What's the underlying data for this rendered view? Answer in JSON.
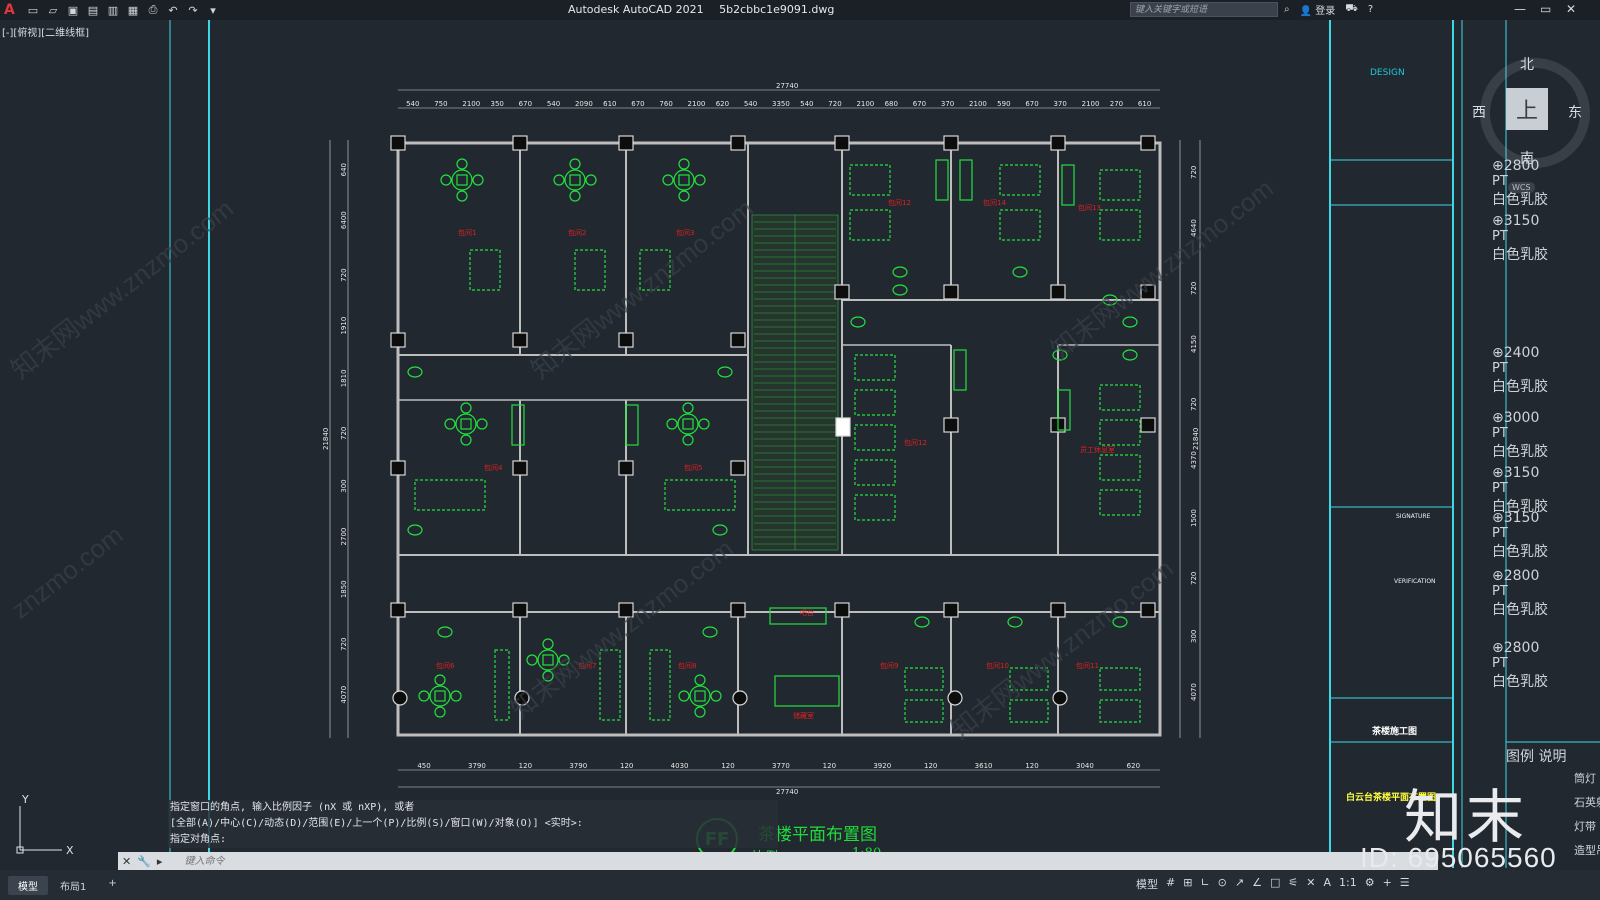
{
  "app": {
    "title": "Autodesk AutoCAD 2021",
    "file": "5b2cbbc1e9091.dwg",
    "logo": "A"
  },
  "search": {
    "placeholder": "键入关键字或短语"
  },
  "user": {
    "login": "登录"
  },
  "viewport": {
    "label": "[-][俯视][二维线框]"
  },
  "compass": {
    "north": "北",
    "south": "南",
    "east": "东",
    "west": "西",
    "top": "上",
    "wcs": "WCS"
  },
  "plan": {
    "total_width": "27740",
    "top_dims": [
      "540",
      "750",
      "2100",
      "350",
      "670",
      "540",
      "2090",
      "610",
      "670",
      "760",
      "2100",
      "620",
      "540",
      "3350",
      "540",
      "720",
      "2100",
      "680",
      "670",
      "370",
      "2100",
      "590",
      "670",
      "370",
      "2100",
      "270",
      "610"
    ],
    "bottom_dims": [
      "450",
      "3790",
      "120",
      "3790",
      "120",
      "4030",
      "120",
      "3770",
      "120",
      "3920",
      "120",
      "3610",
      "120",
      "3040",
      "620"
    ],
    "left_dims": [
      "640",
      "6400",
      "720",
      "1910",
      "1810",
      "720",
      "300",
      "2700",
      "1850",
      "720",
      "4070"
    ],
    "right_dims": [
      "720",
      "4640",
      "720",
      "4150",
      "720",
      "4370",
      "1500",
      "720",
      "300",
      "4070"
    ],
    "total_height": "21840",
    "rooms": [
      "包间1",
      "包间2",
      "包间3",
      "包间4",
      "包间5",
      "包间6",
      "包间7",
      "包间8",
      "包间9",
      "包间10",
      "包间11",
      "包间12",
      "包间13",
      "包间14",
      "包间12",
      "员工休息室",
      "吧台",
      "储藏室"
    ],
    "title": "茶楼平面布置图",
    "scale_label": "比例",
    "scale": "1:80",
    "badge": "FF"
  },
  "title_block": {
    "design": "DESIGN",
    "signature": "SIGNATURE",
    "verification": "VERIFICATION",
    "project_name": "茶楼施工图",
    "drawing_name": "白云台茶楼平面布置图"
  },
  "legend": {
    "items": [
      {
        "height": "2800",
        "code": "PT",
        "material": "白色乳胶"
      },
      {
        "height": "3150",
        "code": "PT",
        "material": "白色乳胶"
      },
      {
        "height": "2400",
        "code": "PT",
        "material": "白色乳胶"
      },
      {
        "height": "3000",
        "code": "PT",
        "material": "白色乳胶"
      },
      {
        "height": "3150",
        "code": "PT",
        "material": "白色乳胶"
      },
      {
        "height": "3150",
        "code": "PT",
        "material": "白色乳胶"
      },
      {
        "height": "2800",
        "code": "PT",
        "material": "白色乳胶"
      },
      {
        "height": "2800",
        "code": "PT",
        "material": "白色乳胶"
      }
    ],
    "header": [
      "图例",
      "说明"
    ],
    "rows": [
      "筒灯",
      "石英射",
      "灯带",
      "造型吊"
    ]
  },
  "command_history": [
    "指定窗口的角点, 输入比例因子 (nX 或 nXP), 或者",
    "[全部(A)/中心(C)/动态(D)/范围(E)/上一个(P)/比例(S)/窗口(W)/对象(O)] <实时>:",
    "指定对角点:"
  ],
  "command_input": {
    "placeholder": "键入命令"
  },
  "layout_tabs": [
    "模型",
    "布局1",
    "+"
  ],
  "status_tools": [
    "模型",
    "#",
    "⊞",
    "∟",
    "⊙",
    "↗",
    "∠",
    "□",
    "⚟",
    "✕",
    "A",
    "1:1",
    "⚙",
    "+",
    "☰"
  ],
  "watermark": {
    "logo": "知末",
    "id": "ID: 695065560"
  },
  "colors": {
    "accent": "#1fdc3a",
    "wall": "#c8c8c8",
    "cyan_frame": "#1ec8d8",
    "room_label": "#e02020",
    "stair": "#2a3a36"
  }
}
